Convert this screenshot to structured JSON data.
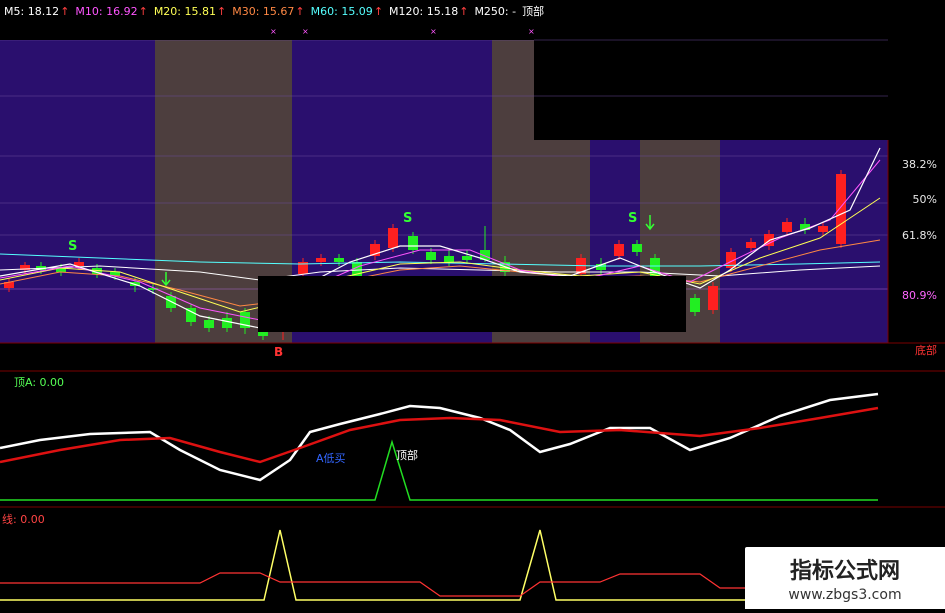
{
  "legend": [
    {
      "label": "M5: 18.12",
      "color": "#ffffff",
      "arrow": "↑"
    },
    {
      "label": "M10: 16.92",
      "color": "#ff55ff",
      "arrow": "↑"
    },
    {
      "label": "M20: 15.81",
      "color": "#ffff55",
      "arrow": "↑"
    },
    {
      "label": "M30: 15.67",
      "color": "#ff8844",
      "arrow": "↑"
    },
    {
      "label": "M60: 15.09",
      "color": "#55ffff",
      "arrow": "↑"
    },
    {
      "label": "M120: 15.18",
      "color": "#ffffff",
      "arrow": "↑"
    },
    {
      "label": "M250: -",
      "color": "#ffffff",
      "arrow": ""
    },
    {
      "label": "顶部",
      "color": "#ffffff",
      "arrow": ""
    }
  ],
  "fib_labels": [
    "38.2%",
    "50%",
    "61.8%",
    "80.9%"
  ],
  "bottom_label": "底部",
  "signals": {
    "s": "S",
    "b": "B",
    "low_buy": "A低买",
    "top": "顶部"
  },
  "pane2_label": "顶A: 0.00",
  "pane3_label": "线: 0.00",
  "watermark": {
    "title": "指标公式网",
    "url": "www.zbgs3.com"
  },
  "colors": {
    "bg": "#000000",
    "purple": "#2a0f6e",
    "gray": "#4d3e3e",
    "up": "#ff2020",
    "down": "#22ee22",
    "grid": "#7a0000",
    "white_line": "#ffffff",
    "red_line": "#dd1111",
    "green_line": "#22dd22",
    "yellow_line": "#ffff66",
    "orange_line": "#ff7722"
  }
}
